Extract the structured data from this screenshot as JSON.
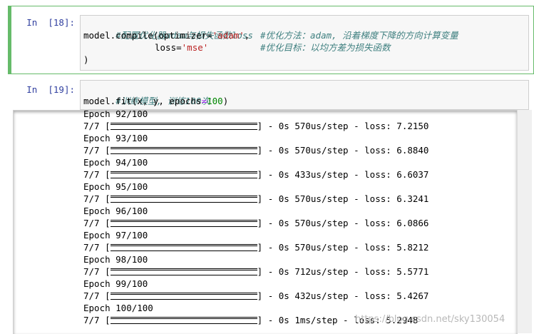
{
  "cell1": {
    "prompt": "In  [18]:",
    "line1_comment": "#配置优化器adam与损失函数loss",
    "line2_code_a": "model.compile(optimizer=",
    "line2_str": "'adam'",
    "line2_code_b": ",",
    "line2_comment": "#优化方法：adam, 沿着梯度下降的方向计算变量",
    "line3_code_a": "loss=",
    "line3_str": "'mse'",
    "line3_comment": "#优化目标：以均方差为损失函数",
    "line4": ")"
  },
  "cell2": {
    "prompt": "In  [19]:",
    "line1_comment": "#训练模型, 训练100次",
    "line2_code_a": "model.fit(x, y, epochs",
    "line2_op": "=",
    "line2_num": "100",
    "line2_code_b": ")"
  },
  "output": {
    "lines": [
      {
        "epoch": "Epoch 92/100",
        "step": "7/7 [",
        "tail": "] - 0s 570us/step - loss: 7.2150"
      },
      {
        "epoch": "Epoch 93/100",
        "step": "7/7 [",
        "tail": "] - 0s 570us/step - loss: 6.8840"
      },
      {
        "epoch": "Epoch 94/100",
        "step": "7/7 [",
        "tail": "] - 0s 433us/step - loss: 6.6037"
      },
      {
        "epoch": "Epoch 95/100",
        "step": "7/7 [",
        "tail": "] - 0s 570us/step - loss: 6.3241"
      },
      {
        "epoch": "Epoch 96/100",
        "step": "7/7 [",
        "tail": "] - 0s 570us/step - loss: 6.0866"
      },
      {
        "epoch": "Epoch 97/100",
        "step": "7/7 [",
        "tail": "] - 0s 570us/step - loss: 5.8212"
      },
      {
        "epoch": "Epoch 98/100",
        "step": "7/7 [",
        "tail": "] - 0s 712us/step - loss: 5.5771"
      },
      {
        "epoch": "Epoch 99/100",
        "step": "7/7 [",
        "tail": "] - 0s 432us/step - loss: 5.4267"
      },
      {
        "epoch": "Epoch 100/100",
        "step": "7/7 [",
        "tail": "] - 0s 1ms/step - loss: 5.2948"
      }
    ]
  },
  "watermark": "https://blog.csdn.net/sky130054",
  "colors": {
    "selected_border": "#66bb6a",
    "prompt": "#303f9f",
    "comment": "#408080",
    "string": "#ba2121",
    "number": "#008800"
  }
}
